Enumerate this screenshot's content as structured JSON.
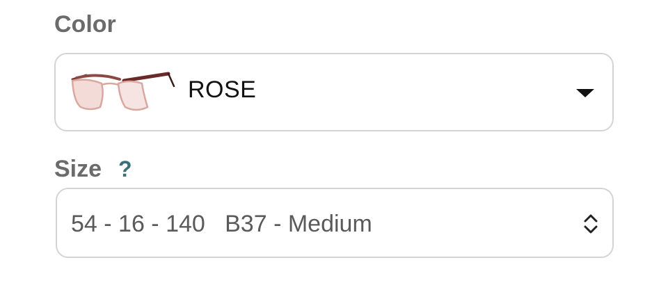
{
  "color_field": {
    "label": "Color",
    "selected_value": "ROSE",
    "thumbnail_icon": "eyeglasses-rose-thumbnail",
    "dropdown_icon": "caret-down-icon"
  },
  "size_field": {
    "label": "Size",
    "help_text": "?",
    "selected_value": "54 - 16 - 140   B37 - Medium",
    "dropdown_icon": "chevron-up-down-icon"
  },
  "colors": {
    "label_text": "#6b6b6b",
    "help_icon": "#3c6f78",
    "border": "#d4d4d4",
    "frame_rose": "#d9a7a0",
    "temple_tortoise": "#6b2a2a"
  }
}
